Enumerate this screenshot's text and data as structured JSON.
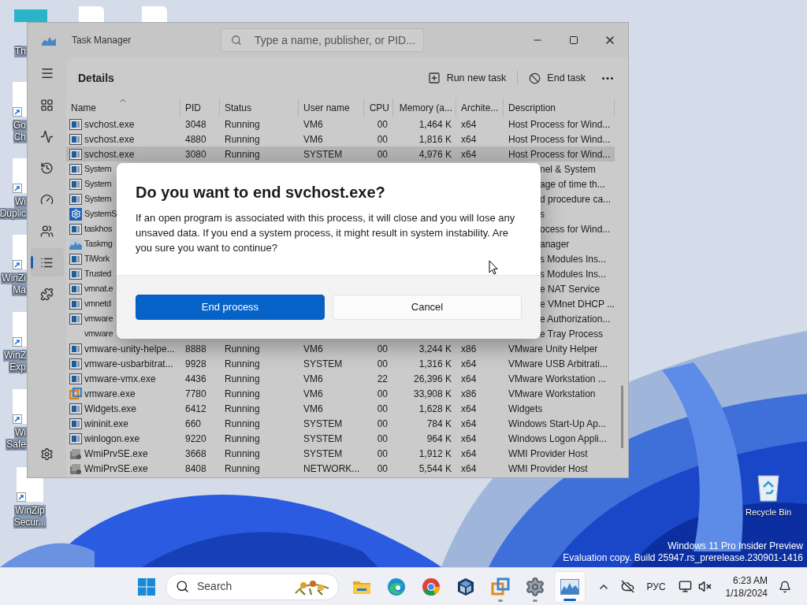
{
  "desktop": {
    "top_icons": [
      {
        "kind": "monitor"
      },
      {
        "kind": "doc"
      },
      {
        "kind": "doc"
      }
    ],
    "icons": [
      {
        "lines": [
          "Th"
        ]
      },
      {
        "lines": [
          "Go",
          "Ch"
        ]
      },
      {
        "lines": [
          "Wi",
          "Duplic"
        ]
      },
      {
        "lines": [
          "WinZi",
          "Ma"
        ]
      },
      {
        "lines": [
          "WinZ",
          "Exp"
        ]
      },
      {
        "lines": [
          "Wi",
          "Safe"
        ]
      },
      {
        "lines": [
          "WinZip",
          "Secur..."
        ]
      }
    ],
    "recycle_bin": {
      "label": "Recycle Bin"
    },
    "watermark": [
      "Windows 11 Pro Insider Preview",
      "Evaluation copy. Build 25947.rs_prerelease.230901-1416"
    ]
  },
  "window": {
    "title": "Task Manager",
    "search": {
      "placeholder": "Type a name, publisher, or PID..."
    },
    "nav": [
      {
        "selected": false
      },
      {
        "selected": false
      },
      {
        "selected": false
      },
      {
        "selected": false
      },
      {
        "selected": false
      },
      {
        "selected": true
      },
      {
        "selected": false
      }
    ],
    "page_title": "Details",
    "toolbar": [
      "Run new task",
      "End task"
    ]
  },
  "table": {
    "columns": [
      {
        "label": "Name",
        "sorted": true
      },
      {
        "label": "PID",
        "sorted": false
      },
      {
        "label": "Status",
        "sorted": false
      },
      {
        "label": "User name",
        "sorted": false
      },
      {
        "label": "CPU",
        "sorted": false
      },
      {
        "label": "Memory (a...",
        "sorted": false
      },
      {
        "label": "Archite...",
        "sorted": false
      },
      {
        "label": "Description",
        "sorted": false
      }
    ],
    "rows": [
      {
        "kind": "window",
        "selected": false,
        "cells": [
          "svchost.exe",
          "3048",
          "Running",
          "VM6",
          "00",
          "1,464 K",
          "x64",
          "Host Process for Wind..."
        ]
      },
      {
        "kind": "window",
        "selected": false,
        "cells": [
          "svchost.exe",
          "4880",
          "Running",
          "VM6",
          "00",
          "1,816 K",
          "x64",
          "Host Process for Wind..."
        ]
      },
      {
        "kind": "window",
        "selected": true,
        "cells": [
          "svchost.exe",
          "3080",
          "Running",
          "SYSTEM",
          "00",
          "4,976 K",
          "x64",
          "Host Process for Wind..."
        ]
      },
      {
        "kind": "window",
        "selected": false,
        "name": "System",
        "description": "nel & System"
      },
      {
        "kind": "window",
        "selected": false,
        "name": "System",
        "description": "age of time th..."
      },
      {
        "kind": "window",
        "selected": false,
        "name": "System",
        "description": "d procedure ca..."
      },
      {
        "kind": "gear",
        "selected": false,
        "name": "SystemS",
        "description": "s"
      },
      {
        "kind": "window",
        "selected": false,
        "name": "taskhos",
        "description": "ocess for Wind..."
      },
      {
        "kind": "chart",
        "selected": false,
        "name": "Taskmg",
        "description": "anager"
      },
      {
        "kind": "window",
        "selected": false,
        "name": "TiWork",
        "description": "s Modules Ins..."
      },
      {
        "kind": "window",
        "selected": false,
        "name": "Trusted",
        "description": "s Modules Ins..."
      },
      {
        "kind": "window",
        "selected": false,
        "name": "vmnat.e",
        "description": "e NAT Service"
      },
      {
        "kind": "window",
        "selected": false,
        "name": "vmnetd",
        "description": "e VMnet DHCP ..."
      },
      {
        "kind": "window",
        "selected": false,
        "name": "vmware",
        "description": "e Authorization..."
      },
      {
        "kind": "none",
        "selected": false,
        "name": "vmware",
        "description": "e Tray Process"
      },
      {
        "kind": "window",
        "selected": false,
        "cells": [
          "vmware-unity-helpe...",
          "8888",
          "Running",
          "VM6",
          "00",
          "3,244 K",
          "x86",
          "VMware Unity Helper"
        ]
      },
      {
        "kind": "window",
        "selected": false,
        "cells": [
          "vmware-usbarbitrat...",
          "9928",
          "Running",
          "SYSTEM",
          "00",
          "1,316 K",
          "x64",
          "VMware USB Arbitrati..."
        ]
      },
      {
        "kind": "window",
        "selected": false,
        "cells": [
          "vmware-vmx.exe",
          "4436",
          "Running",
          "VM6",
          "22",
          "26,396 K",
          "x64",
          "VMware Workstation ..."
        ]
      },
      {
        "kind": "vmware",
        "selected": false,
        "cells": [
          "vmware.exe",
          "7780",
          "Running",
          "VM6",
          "00",
          "33,908 K",
          "x86",
          "VMware Workstation"
        ]
      },
      {
        "kind": "window",
        "selected": false,
        "cells": [
          "Widgets.exe",
          "6412",
          "Running",
          "VM6",
          "00",
          "1,628 K",
          "x64",
          "Widgets"
        ]
      },
      {
        "kind": "window",
        "selected": false,
        "cells": [
          "wininit.exe",
          "660",
          "Running",
          "SYSTEM",
          "00",
          "784 K",
          "x64",
          "Windows Start-Up Ap..."
        ]
      },
      {
        "kind": "window",
        "selected": false,
        "cells": [
          "winlogon.exe",
          "9220",
          "Running",
          "SYSTEM",
          "00",
          "964 K",
          "x64",
          "Windows Logon Appli..."
        ]
      },
      {
        "kind": "wmi",
        "selected": false,
        "cells": [
          "WmiPrvSE.exe",
          "3668",
          "Running",
          "SYSTEM",
          "00",
          "1,912 K",
          "x64",
          "WMI Provider Host"
        ]
      },
      {
        "kind": "wmi",
        "selected": false,
        "cells": [
          "WmiPrvSE.exe",
          "8408",
          "Running",
          "NETWORK...",
          "00",
          "5,544 K",
          "x64",
          "WMI Provider Host"
        ]
      }
    ]
  },
  "dialog": {
    "title": "Do you want to end svchost.exe?",
    "message": "If an open program is associated with this process, it will close and you will lose any unsaved data. If you end a system process, it might result in system instability. Are you sure you want to continue?",
    "buttons": [
      {
        "label": "End process",
        "kind": "primary"
      },
      {
        "label": "Cancel",
        "kind": "secondary"
      }
    ]
  },
  "taskbar": {
    "search": {
      "placeholder": "Search"
    },
    "apps": [
      {
        "kind": "folder",
        "running": false,
        "selected": false
      },
      {
        "kind": "edge",
        "running": false,
        "selected": false
      },
      {
        "kind": "chrome",
        "running": false,
        "selected": false
      },
      {
        "kind": "virtualbox",
        "running": false,
        "selected": false
      },
      {
        "kind": "vmware",
        "running": true,
        "selected": false
      },
      {
        "kind": "settings",
        "running": true,
        "selected": false
      },
      {
        "kind": "taskmanager",
        "running": true,
        "selected": true
      }
    ],
    "tray": {
      "language": "РУС",
      "time": "6:23 AM",
      "date": "1/18/2024"
    }
  }
}
